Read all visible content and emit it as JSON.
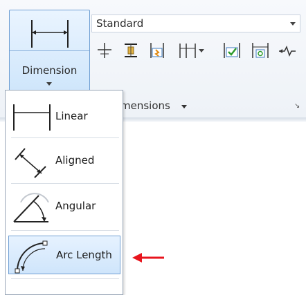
{
  "ribbon": {
    "big_button_label": "Dimension",
    "dim_style_value": "Standard",
    "panel_title": "mensions",
    "tool_icons": [
      "dim-baseline-icon",
      "dim-space-icon",
      "dim-break-icon",
      "dim-continue-icon",
      "dropdown-arrow-icon",
      "inspect-icon",
      "dim-update-icon",
      "jogged-linear-icon"
    ]
  },
  "menu": {
    "items": [
      {
        "label": "Linear",
        "icon": "linear-dimension-icon"
      },
      {
        "label": "Aligned",
        "icon": "aligned-dimension-icon"
      },
      {
        "label": "Angular",
        "icon": "angular-dimension-icon"
      },
      {
        "label": "Arc Length",
        "icon": "arc-length-icon",
        "selected": true
      }
    ]
  },
  "colors": {
    "accent_blue": "#6f9fd3",
    "selected_fill": "#cfe5fb",
    "callout_red": "#e8141d"
  }
}
